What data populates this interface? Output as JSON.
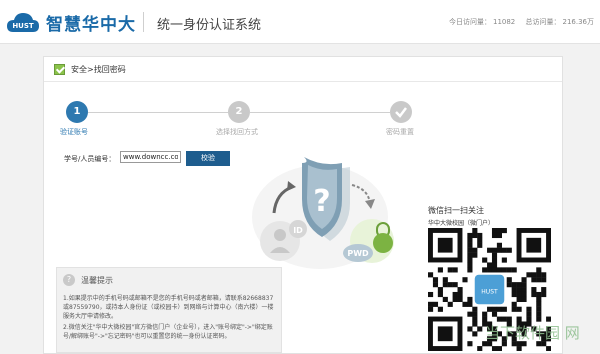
{
  "header": {
    "brand": "智慧华中大",
    "logo_text": "HUST",
    "system_title": "统一身份认证系统",
    "today_visits_label": "今日访问量：",
    "today_visits_value": "11082",
    "total_visits_label": "总访问量：",
    "total_visits_value": "216.36万"
  },
  "breadcrumb": "安全>找回密码",
  "steps": [
    {
      "number": "1",
      "label": "验证账号"
    },
    {
      "number": "2",
      "label": "选择找回方式"
    },
    {
      "number": "",
      "label": "密码重置"
    }
  ],
  "form": {
    "label": "学号/人员编号：",
    "value": "www.downcc.com",
    "button": "校验"
  },
  "illustration": {
    "id_badge": "ID",
    "pwd_badge": "PWD",
    "question_mark": "?"
  },
  "tips": {
    "icon": "?",
    "title": "温馨提示",
    "line1": "1.如果提示中的手机号码或邮箱不是您的手机号码或者邮箱，请联系82668837或87559790，或持本人身份证（或校园卡）到网络与计算中心（南六楼）一楼服务大厅申请修改。",
    "line2": "2.微信关注\"华中大微校园\"官方微信门户（企业号），进入\"账号绑定\"->\"绑定账号/解绑账号\"->\"忘记密码\"也可以重置您的统一身份认证密码。"
  },
  "qr": {
    "title": "微信扫一扫关注",
    "subtitle": "华中大微校园（微门户）"
  },
  "watermark": "当下软件园 网",
  "colors": {
    "brand_blue": "#1a6aa8",
    "step_active": "#2e79b0",
    "step_inactive": "#c9c9c9",
    "button": "#1e5d8e"
  }
}
